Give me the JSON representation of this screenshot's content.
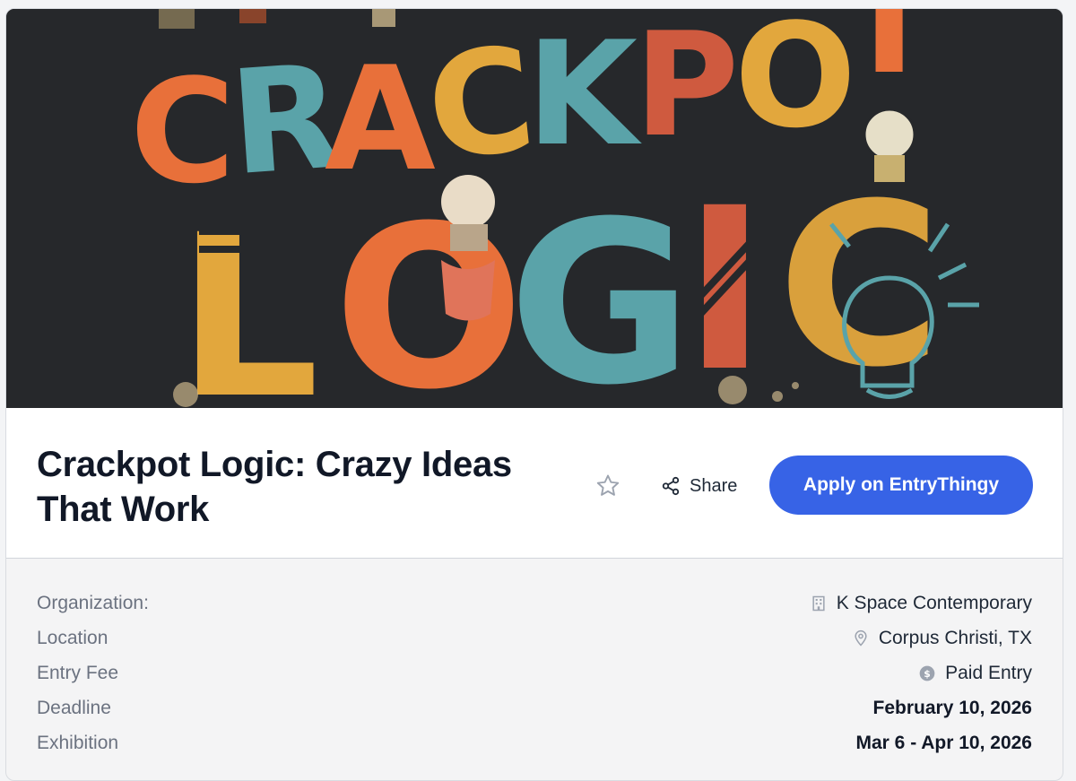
{
  "hero": {
    "image_text": [
      "CRACKPOT",
      "LOGIC"
    ]
  },
  "listing": {
    "title": "Crackpot Logic: Crazy Ideas That Work",
    "share_label": "Share",
    "apply_label": "Apply on EntryThingy"
  },
  "details": [
    {
      "label": "Organization:",
      "value": "K Space Contemporary",
      "icon": "building-icon"
    },
    {
      "label": "Location",
      "value": "Corpus Christi, TX",
      "icon": "map-pin-icon"
    },
    {
      "label": "Entry Fee",
      "value": "Paid Entry",
      "icon": "dollar-coin-icon"
    },
    {
      "label": "Deadline",
      "value": "February 10, 2026"
    },
    {
      "label": "Exhibition",
      "value": "Mar 6 - Apr 10, 2026"
    }
  ],
  "colors": {
    "accent": "#3763e6",
    "hero_bg": "#26282b",
    "letter_orange": "#e8703a",
    "letter_teal": "#5aa3a9",
    "letter_mustard": "#e2a73d",
    "letter_red": "#cf5a3f"
  }
}
